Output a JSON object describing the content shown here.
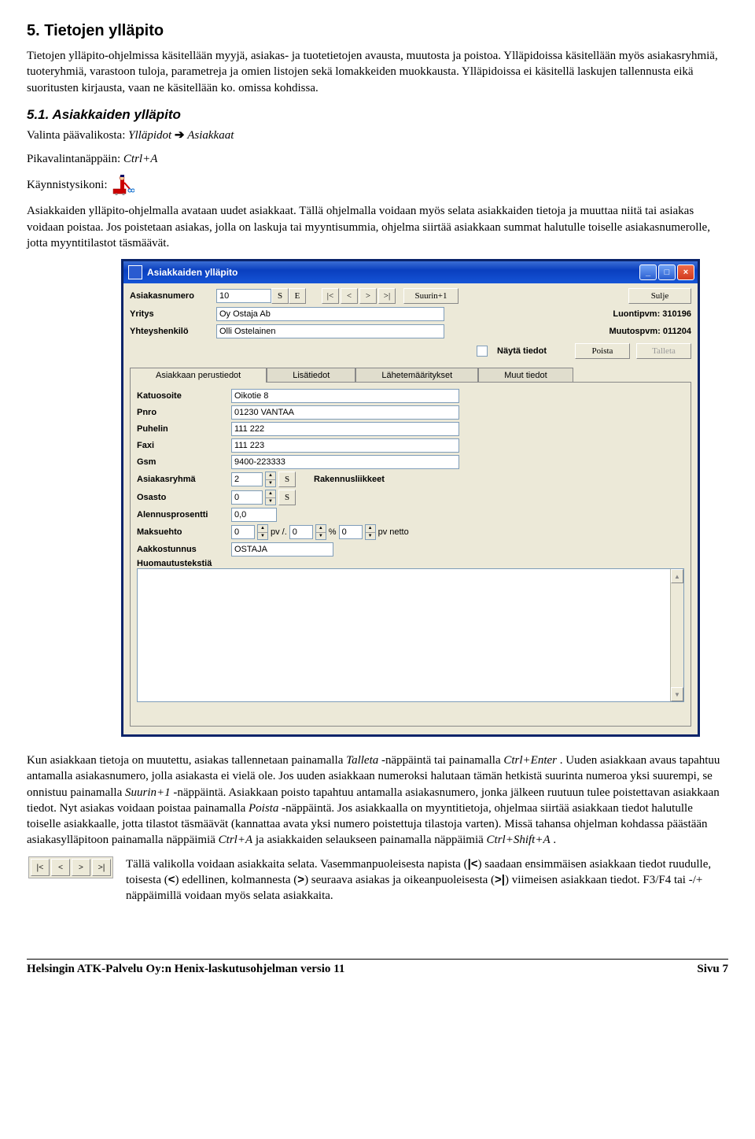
{
  "section": {
    "title": "5. Tietojen ylläpito",
    "intro": "Tietojen ylläpito-ohjelmissa käsitellään myyjä, asiakas- ja tuotetietojen avausta, muutosta ja poistoa. Ylläpidoissa käsitellään myös asiakasryhmiä, tuoteryhmiä, varastoon tuloja, parametreja ja omien listojen sekä lomakkeiden muokkausta. Ylläpidoissa ei käsitellä laskujen tallennusta eikä suoritusten kirjausta, vaan ne käsitellään ko. omissa kohdissa."
  },
  "subsection": {
    "title": "5.1. Asiakkaiden ylläpito",
    "menu_prefix": "Valinta päävalikosta: ",
    "menu_path1": "Ylläpidot",
    "menu_path2": "Asiakkaat",
    "shortcut_prefix": "Pikavalintanäppäin: ",
    "shortcut": "Ctrl+A",
    "launch_label": "Käynnistysikoni:",
    "para1": "Asiakkaiden ylläpito-ohjelmalla avataan uudet asiakkaat. Tällä ohjelmalla voidaan myös selata asiakkaiden tietoja ja muuttaa niitä tai asiakas voidaan poistaa. Jos poistetaan asiakas, jolla on laskuja tai myyntisummia, ohjelma siirtää asiakkaan summat halutulle toiselle asiakasnumerolle, jotta myyntitilastot täsmäävät."
  },
  "window": {
    "title": "Asiakkaiden ylläpito",
    "labels": {
      "asiakasnumero": "Asiakasnumero",
      "yritys": "Yritys",
      "yhteyshenkilo": "Yhteyshenkilö",
      "nayta": "Näytä tiedot",
      "luontipvm": "Luontipvm: 310196",
      "muutospvm": "Muutospvm: 011204"
    },
    "values": {
      "asiakasnumero": "10",
      "yritys": "Oy Ostaja Ab",
      "yhteyshenkilo": "Olli Ostelainen"
    },
    "buttons": {
      "s": "S",
      "e": "E",
      "first": "|<",
      "prev": "<",
      "next": ">",
      "last": ">|",
      "suurin": "Suurin+1",
      "sulje": "Sulje",
      "poista": "Poista",
      "talleta": "Talleta"
    },
    "tabs": {
      "t1": "Asiakkaan perustiedot",
      "t2": "Lisätiedot",
      "t3": "Lähetemääritykset",
      "t4": "Muut tiedot"
    },
    "form": {
      "katuosoite_l": "Katuosoite",
      "katuosoite": "Oikotie 8",
      "pnro_l": "Pnro",
      "pnro": "01230 VANTAA",
      "puhelin_l": "Puhelin",
      "puhelin": "111 222",
      "faxi_l": "Faxi",
      "faxi": "111 223",
      "gsm_l": "Gsm",
      "gsm": "9400-223333",
      "asiakasryhma_l": "Asiakasryhmä",
      "asiakasryhma": "2",
      "asiakasryhma_name": "Rakennusliikkeet",
      "osasto_l": "Osasto",
      "osasto": "0",
      "alennus_l": "Alennusprosentti",
      "alennus": "0,0",
      "maksuehto_l": "Maksuehto",
      "maksuehto_a": "0",
      "maksuehto_b": "0",
      "maksuehto_c": "0",
      "maksuehto_t1": "pv /.",
      "maksuehto_t2": "%",
      "maksuehto_t3": "pv netto",
      "aakkos_l": "Aakkostunnus",
      "aakkos": "OSTAJA",
      "huom_l": "Huomautustekstiä"
    }
  },
  "after": {
    "p1a": "Kun asiakkaan tietoja on muutettu, asiakas tallennetaan painamalla ",
    "p1b": "Talleta",
    "p1c": "-näppäintä tai painamalla ",
    "p1d": "Ctrl+Enter",
    "p1e": ". Uuden asiakkaan avaus tapahtuu antamalla asiakasnumero, jolla asiakasta ei vielä ole. Jos uuden asiakkaan numeroksi halutaan tämän hetkistä suurinta numeroa yksi suurempi, se onnistuu painamalla ",
    "p1f": "Suurin+1",
    "p1g": " -näppäintä. Asiakkaan poisto tapahtuu antamalla asiakasnumero, jonka jälkeen ruutuun tulee poistettavan asiakkaan tiedot. Nyt asiakas voidaan poistaa painamalla ",
    "p1h": "Poista",
    "p1i": " -näppäintä. Jos asiakkaalla on myyntitietoja, ohjelmaa siirtää asiakkaan tiedot halutulle toiselle asiakkaalle, jotta tilastot täsmäävät (kannattaa avata yksi numero poistettuja tilastoja varten). Missä tahansa ohjelman kohdassa päästään asiakasylläpitoon painamalla näppäimiä ",
    "p1j": "Ctrl+A",
    "p1k": " ja asiakkaiden selaukseen painamalla näppäimiä ",
    "p1l": "Ctrl+Shift+A",
    "p1m": ".",
    "p2a": "Tällä valikolla voidaan asiakkaita selata. Vasemmanpuoleisesta napista (",
    "p2b": ") saadaan ensimmäisen asiakkaan tiedot ruudulle, toisesta (",
    "p2c": ") edellinen, kolmannesta (",
    "p2d": ") seuraava asiakas ja oikeanpuoleisesta (",
    "p2e": ") viimeisen asiakkaan tiedot. F3/F4 tai -/+ näppäimillä voidaan myös selata asiakkaita."
  },
  "nav_syms": {
    "first": "|<",
    "prev": "<",
    "next": ">",
    "last": ">|"
  },
  "footer": {
    "left": "Helsingin ATK-Palvelu Oy:n Henix-laskutusohjelman versio 11",
    "right": "Sivu 7"
  }
}
